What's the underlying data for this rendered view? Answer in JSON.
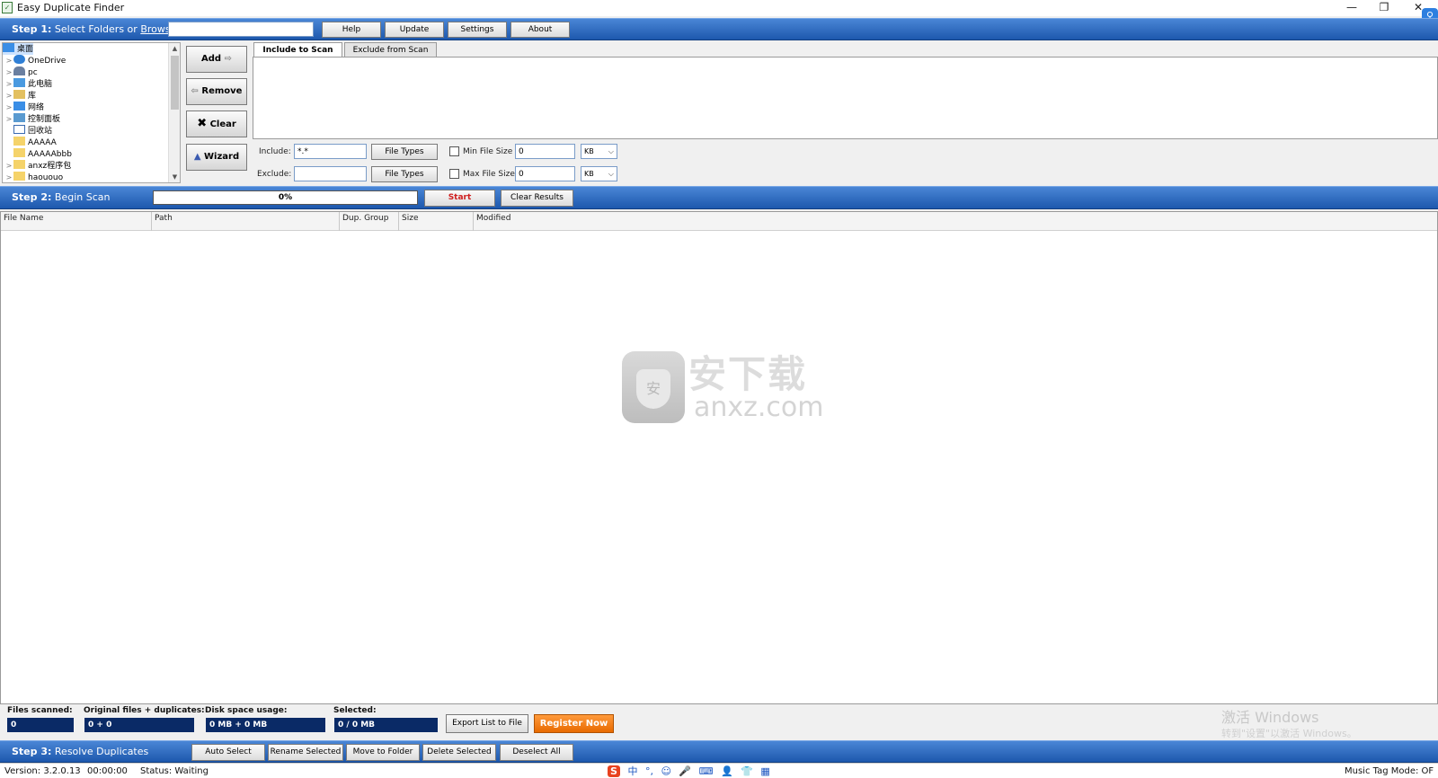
{
  "window": {
    "title": "Easy Duplicate Finder",
    "icon": "app-icon",
    "minimize_glyph": "—",
    "maximize_glyph": "❐",
    "close_glyph": "✕"
  },
  "step1": {
    "prefix": "Step 1:",
    "text": " Select Folders or ",
    "browse_link": "Browse",
    "path_value": "",
    "buttons": {
      "help": "Help",
      "update": "Update",
      "settings": "Settings",
      "about": "About"
    }
  },
  "tree": {
    "items": [
      {
        "label": "桌面",
        "icon": "desktop-icon",
        "selected": true
      },
      {
        "label": "OneDrive",
        "icon": "cloud-icon",
        "expander": ">"
      },
      {
        "label": "pc",
        "icon": "user-icon",
        "expander": ">"
      },
      {
        "label": "此电脑",
        "icon": "computer-icon",
        "expander": ">"
      },
      {
        "label": "库",
        "icon": "library-icon",
        "expander": ">"
      },
      {
        "label": "网络",
        "icon": "network-icon",
        "expander": ">"
      },
      {
        "label": "控制面板",
        "icon": "control-panel-icon",
        "expander": ">"
      },
      {
        "label": "回收站",
        "icon": "recycle-bin-icon"
      },
      {
        "label": "AAAAA",
        "icon": "folder-icon"
      },
      {
        "label": "AAAAAbbb",
        "icon": "folder-icon"
      },
      {
        "label": "anxz程序包",
        "icon": "folder-icon",
        "expander": ">"
      },
      {
        "label": "haououo",
        "icon": "folder-icon",
        "expander": ">"
      }
    ]
  },
  "side_buttons": {
    "add": "Add",
    "remove": "Remove",
    "clear": "Clear",
    "wizard": "Wizard"
  },
  "tabs": {
    "include": "Include to Scan",
    "exclude": "Exclude from Scan"
  },
  "filters": {
    "include_label": "Include:",
    "include_value": "*.*",
    "exclude_label": "Exclude:",
    "exclude_value": "",
    "file_types_label": "File Types",
    "min_size_label": "Min File Size",
    "min_size_value": "0",
    "min_size_unit": "KB",
    "max_size_label": "Max File Size",
    "max_size_value": "0",
    "max_size_unit": "KB"
  },
  "step2": {
    "prefix": "Step 2:",
    "text": " Begin Scan",
    "progress_text": "0%",
    "progress_fraction": 0,
    "start": "Start",
    "clear_results": "Clear Results"
  },
  "grid": {
    "columns": [
      "File Name",
      "Path",
      "Dup. Group",
      "Size",
      "Modified"
    ],
    "rows": []
  },
  "watermark": {
    "chinese": "安下载",
    "english": "anxz.com"
  },
  "stats": {
    "files_scanned_label": "Files scanned:",
    "files_scanned_value": "0",
    "orig_dup_label": "Original files + duplicates:",
    "orig_dup_value": "0 + 0",
    "disk_label": "Disk space usage:",
    "disk_value": "0 MB + 0 MB",
    "selected_label": "Selected:",
    "selected_value": "0 / 0 MB",
    "export": "Export List to File",
    "register": "Register Now"
  },
  "activation": {
    "line1": "激活 Windows",
    "line2": "转到\"设置\"以激活 Windows。"
  },
  "step3": {
    "prefix": "Step 3:",
    "text": " Resolve Duplicates",
    "buttons": {
      "auto_select": "Auto Select",
      "rename_selected": "Rename Selected",
      "move_to_folder": "Move to Folder",
      "delete_selected": "Delete Selected",
      "deselect_all": "Deselect All"
    }
  },
  "status": {
    "version": "Version: 3.2.0.13",
    "time": "00:00:00",
    "status": "Status: Waiting",
    "music_tag": "Music Tag Mode: OF"
  },
  "ime": {
    "logo": "S",
    "items": [
      "中",
      "°,",
      "☺",
      "🎤",
      "⌨",
      "👤",
      "👕",
      "▦"
    ]
  }
}
